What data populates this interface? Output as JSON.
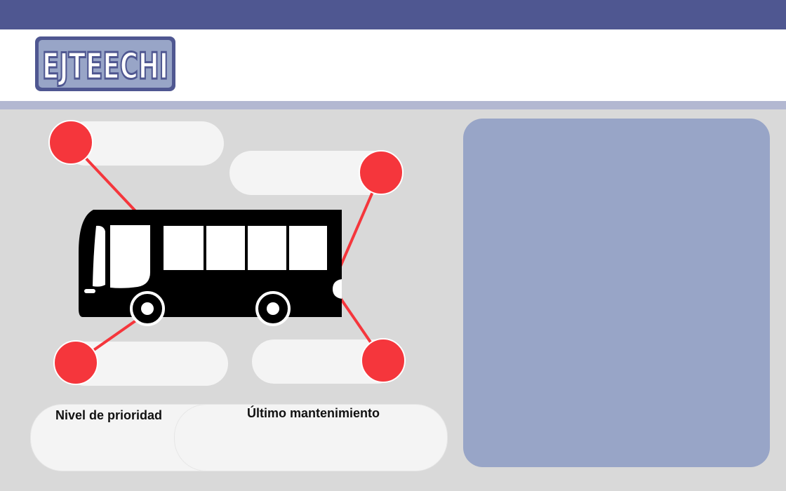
{
  "header": {
    "logo_text": "EJTEECHI"
  },
  "cards": {
    "priority_label": "Nivel de prioridad",
    "maintenance_label": "Último mantenimiento"
  },
  "diagram": {
    "illustration": "bus-icon",
    "node_count": 4
  },
  "colors": {
    "top_bar": "#4f5791",
    "header_stripe": "#b3b8d1",
    "background": "#d9d9d9",
    "node_red": "#f5363c",
    "side_panel": "#98a5c7",
    "pill": "#f4f4f4"
  }
}
